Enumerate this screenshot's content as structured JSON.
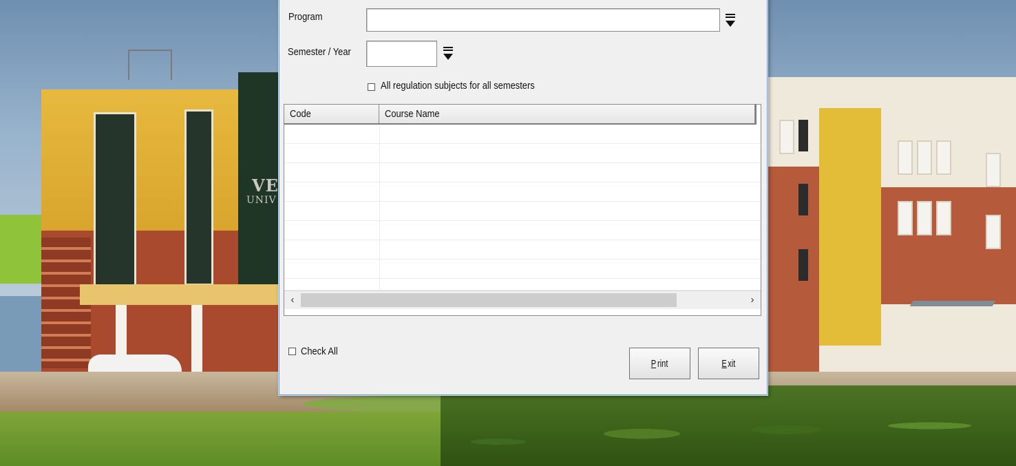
{
  "dialog": {
    "program_label": "Program",
    "program_value": "",
    "semester_label": "Semester / Year",
    "semester_value": "",
    "all_regulation_label": "All regulation subjects for all semesters",
    "all_regulation_checked": false,
    "check_all_label": "Check All",
    "check_all_checked": false
  },
  "table": {
    "columns": [
      "Code",
      "Course Name"
    ],
    "rows": []
  },
  "buttons": {
    "print_mnemonic": "P",
    "print_rest": "rint",
    "exit_mnemonic": "E",
    "exit_rest": "xit"
  },
  "background": {
    "sign_line1": "VE",
    "sign_line2": "UNIV"
  },
  "icons": {
    "dropdown": "dropdown-arrow-icon",
    "scroll_left": "scroll-left-icon",
    "scroll_right": "scroll-right-icon"
  }
}
